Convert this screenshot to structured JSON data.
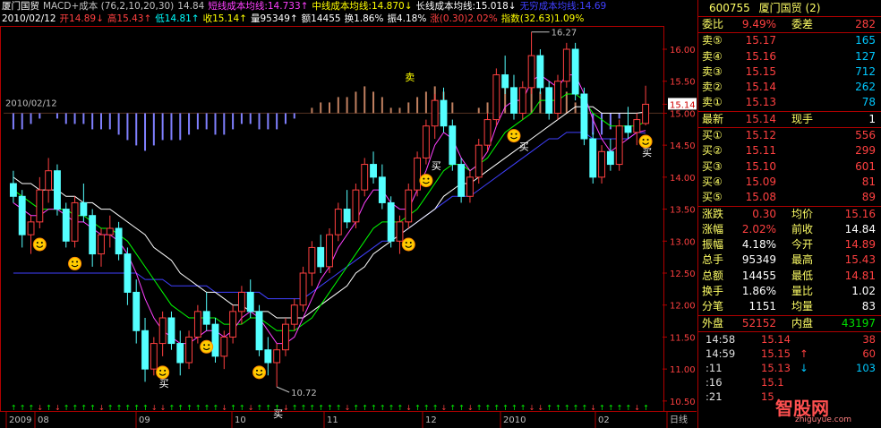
{
  "header": {
    "line1": [
      "厦门国贸",
      "MACD+成本 (76,2,10,20,30)",
      "14.84",
      "短线成本均线:14.733↑",
      "中线成本均线:14.870↓",
      "长线成本均线:15.018↓",
      "无穷成本均线:14.69"
    ],
    "line1_colors": [
      "#ffffff",
      "#c0c0c0",
      "#c0c0c0",
      "#ff40ff",
      "#ffff00",
      "#ffffff",
      "#4040ff"
    ],
    "line2": [
      "2010/02/12",
      "开14.89↓",
      "高15.43↑",
      "低14.81↑",
      "收15.14↑",
      "量95349↑",
      "额14455",
      "换1.86%",
      "振4.18%",
      "涨(0.30)2.02%",
      "指数(32.63)1.09%"
    ],
    "line2_colors": [
      "#ffffff",
      "#ff4040",
      "#ff4040",
      "#00ffff",
      "#ffff00",
      "#ffffff",
      "#ffffff",
      "#ffffff",
      "#ffffff",
      "#ff4040",
      "#ffff00"
    ]
  },
  "annotations": {
    "high_label": "16.27",
    "low_label": "10.72",
    "sell": "卖",
    "buy": "买",
    "left_date": "2010/02/12"
  },
  "price_axis": [
    "16.00",
    "15.50",
    "15.14",
    "15.00",
    "14.50",
    "14.00",
    "13.50",
    "13.00",
    "12.50",
    "12.00",
    "11.50",
    "11.00",
    "10.50"
  ],
  "date_axis": [
    "2009",
    "08",
    "09",
    "10",
    "11",
    "12",
    "2010",
    "02",
    "日线"
  ],
  "stock": {
    "code": "600755",
    "name": "厦门国贸",
    "tag": "(2)"
  },
  "quote": {
    "weibi_label": "委比",
    "weibi": "9.49%",
    "weicha_label": "委差",
    "weicha": "282",
    "sells": [
      {
        "label": "卖⑤",
        "price": "15.17",
        "vol": "165"
      },
      {
        "label": "卖④",
        "price": "15.16",
        "vol": "127"
      },
      {
        "label": "卖③",
        "price": "15.15",
        "vol": "712"
      },
      {
        "label": "卖②",
        "price": "15.14",
        "vol": "262"
      },
      {
        "label": "卖①",
        "price": "15.13",
        "vol": "78"
      }
    ],
    "latest_label": "最新",
    "latest": "15.14",
    "xianshou_label": "现手",
    "xianshou": "1",
    "buys": [
      {
        "label": "买①",
        "price": "15.12",
        "vol": "556"
      },
      {
        "label": "买②",
        "price": "15.11",
        "vol": "299"
      },
      {
        "label": "买③",
        "price": "15.10",
        "vol": "601"
      },
      {
        "label": "买④",
        "price": "15.09",
        "vol": "81"
      },
      {
        "label": "买⑤",
        "price": "15.08",
        "vol": "89"
      }
    ],
    "stats": [
      {
        "l1": "涨跌",
        "v1": "0.30",
        "c1": "red",
        "l2": "均价",
        "v2": "15.16",
        "c2": "red"
      },
      {
        "l1": "涨幅",
        "v1": "2.02%",
        "c1": "red",
        "l2": "前收",
        "v2": "14.84",
        "c2": "white"
      },
      {
        "l1": "振幅",
        "v1": "4.18%",
        "c1": "white",
        "l2": "今开",
        "v2": "14.89",
        "c2": "red"
      },
      {
        "l1": "总手",
        "v1": "95349",
        "c1": "white",
        "l2": "最高",
        "v2": "15.43",
        "c2": "red"
      },
      {
        "l1": "总额",
        "v1": "14455",
        "c1": "white",
        "l2": "最低",
        "v2": "14.81",
        "c2": "red"
      },
      {
        "l1": "换手",
        "v1": "1.86%",
        "c1": "white",
        "l2": "量比",
        "v2": "1.02",
        "c2": "white"
      },
      {
        "l1": "分笔",
        "v1": "1151",
        "c1": "white",
        "l2": "均量",
        "v2": "83",
        "c2": "white"
      }
    ],
    "waipan_label": "外盘",
    "waipan": "52152",
    "neipan_label": "内盘",
    "neipan": "43197"
  },
  "ticks": [
    {
      "time": "14:58",
      "price": "15.14",
      "arrow": "",
      "vol": "38",
      "vcolor": "#ff4040"
    },
    {
      "time": "14:59",
      "price": "15.15",
      "arrow": "↑",
      "vol": "60",
      "vcolor": "#ff4040"
    },
    {
      "time": ":11",
      "price": "15.13",
      "arrow": "↓",
      "vol": "103",
      "vcolor": "#00c8ff"
    },
    {
      "time": ":16",
      "price": "15.1",
      "arrow": "",
      "vol": "",
      "vcolor": "#ff4040"
    },
    {
      "time": ":21",
      "price": "15",
      "arrow": "",
      "vol": "",
      "vcolor": "#ff4040"
    }
  ],
  "watermark": {
    "text": "智股网",
    "url": "zhiguyue.com"
  },
  "colors": {
    "up": "#ff4040",
    "down": "#54ffff",
    "frame": "#b00000",
    "ma_short": "#ff40ff",
    "ma_mid": "#ffff00",
    "ma_long": "#ffffff",
    "ma_inf": "#4040ff",
    "ma_green": "#00ff00"
  },
  "chart_data": {
    "type": "candlestick",
    "ylim": [
      10.4,
      16.35
    ],
    "series_names": [
      "短线成本均线",
      "中线成本均线",
      "长线成本均线",
      "无穷成本均线"
    ],
    "candles": [
      [
        13.9,
        14.1,
        13.6,
        13.7
      ],
      [
        13.7,
        13.8,
        12.9,
        13.1
      ],
      [
        13.1,
        13.4,
        12.8,
        13.3
      ],
      [
        13.3,
        14.0,
        13.2,
        13.8
      ],
      [
        13.8,
        14.3,
        13.6,
        14.1
      ],
      [
        14.1,
        14.2,
        13.4,
        13.5
      ],
      [
        13.5,
        13.6,
        12.9,
        13.0
      ],
      [
        13.0,
        13.7,
        12.9,
        13.6
      ],
      [
        13.6,
        13.9,
        13.3,
        13.4
      ],
      [
        13.4,
        13.5,
        12.6,
        12.8
      ],
      [
        12.8,
        13.2,
        12.6,
        13.1
      ],
      [
        13.1,
        13.4,
        12.9,
        13.2
      ],
      [
        13.2,
        13.3,
        12.7,
        12.8
      ],
      [
        12.8,
        12.9,
        12.0,
        12.2
      ],
      [
        12.2,
        12.4,
        11.4,
        11.6
      ],
      [
        11.6,
        11.8,
        10.8,
        11.0
      ],
      [
        11.0,
        11.5,
        10.9,
        11.4
      ],
      [
        11.4,
        11.9,
        11.2,
        11.8
      ],
      [
        11.8,
        11.9,
        11.3,
        11.4
      ],
      [
        11.4,
        11.6,
        10.9,
        11.1
      ],
      [
        11.1,
        11.6,
        11.0,
        11.5
      ],
      [
        11.5,
        12.0,
        11.4,
        11.9
      ],
      [
        11.9,
        12.2,
        11.6,
        11.7
      ],
      [
        11.7,
        11.8,
        11.1,
        11.2
      ],
      [
        11.2,
        11.6,
        11.0,
        11.5
      ],
      [
        11.5,
        12.0,
        11.4,
        11.9
      ],
      [
        11.9,
        12.3,
        11.7,
        12.2
      ],
      [
        12.2,
        12.4,
        11.8,
        11.9
      ],
      [
        11.9,
        12.0,
        11.2,
        11.3
      ],
      [
        11.3,
        11.5,
        10.9,
        11.1
      ],
      [
        11.1,
        11.4,
        10.72,
        11.3
      ],
      [
        11.3,
        11.8,
        11.2,
        11.7
      ],
      [
        11.7,
        12.1,
        11.6,
        12.0
      ],
      [
        12.0,
        12.6,
        11.9,
        12.5
      ],
      [
        12.5,
        13.0,
        12.3,
        12.9
      ],
      [
        12.9,
        13.1,
        12.5,
        12.6
      ],
      [
        12.6,
        13.2,
        12.5,
        13.1
      ],
      [
        13.1,
        13.6,
        13.0,
        13.5
      ],
      [
        13.5,
        13.8,
        13.2,
        13.3
      ],
      [
        13.3,
        13.9,
        13.2,
        13.8
      ],
      [
        13.8,
        14.3,
        13.7,
        14.2
      ],
      [
        14.2,
        14.4,
        13.9,
        14.0
      ],
      [
        14.0,
        14.2,
        13.5,
        13.6
      ],
      [
        13.6,
        13.7,
        12.9,
        13.0
      ],
      [
        13.0,
        13.4,
        12.8,
        13.3
      ],
      [
        13.3,
        13.9,
        13.2,
        13.8
      ],
      [
        13.8,
        14.4,
        13.7,
        14.3
      ],
      [
        14.3,
        14.9,
        14.2,
        14.8
      ],
      [
        14.8,
        15.3,
        14.6,
        15.2
      ],
      [
        15.2,
        15.4,
        14.7,
        14.8
      ],
      [
        14.8,
        14.9,
        14.1,
        14.2
      ],
      [
        14.2,
        14.3,
        13.6,
        13.7
      ],
      [
        13.7,
        14.1,
        13.6,
        14.0
      ],
      [
        14.0,
        14.6,
        13.9,
        14.5
      ],
      [
        14.5,
        15.0,
        14.4,
        14.9
      ],
      [
        14.9,
        15.7,
        14.8,
        15.6
      ],
      [
        15.6,
        15.9,
        15.3,
        15.4
      ],
      [
        15.4,
        15.6,
        14.9,
        15.0
      ],
      [
        15.0,
        15.5,
        14.9,
        15.4
      ],
      [
        15.4,
        16.27,
        15.3,
        15.9
      ],
      [
        15.9,
        16.0,
        15.3,
        15.4
      ],
      [
        15.4,
        15.5,
        14.9,
        15.0
      ],
      [
        15.0,
        15.6,
        14.9,
        15.5
      ],
      [
        15.5,
        16.1,
        15.4,
        16.0
      ],
      [
        16.0,
        16.1,
        15.2,
        15.3
      ],
      [
        15.3,
        15.4,
        14.5,
        14.6
      ],
      [
        14.6,
        14.7,
        13.9,
        14.0
      ],
      [
        14.0,
        14.5,
        13.9,
        14.4
      ],
      [
        14.4,
        14.6,
        14.1,
        14.2
      ],
      [
        14.2,
        14.9,
        14.1,
        14.8
      ],
      [
        14.8,
        15.1,
        14.6,
        14.7
      ],
      [
        14.7,
        15.0,
        14.5,
        14.9
      ],
      [
        14.84,
        15.43,
        14.81,
        15.14
      ]
    ],
    "ma_short": [
      13.6,
      13.5,
      13.4,
      13.4,
      13.5,
      13.5,
      13.4,
      13.3,
      13.3,
      13.2,
      13.1,
      13.1,
      13.0,
      12.8,
      12.5,
      12.1,
      11.8,
      11.6,
      11.5,
      11.4,
      11.4,
      11.5,
      11.6,
      11.6,
      11.5,
      11.6,
      11.8,
      11.9,
      11.8,
      11.6,
      11.4,
      11.4,
      11.5,
      11.8,
      12.1,
      12.4,
      12.6,
      12.9,
      13.1,
      13.3,
      13.6,
      13.8,
      13.8,
      13.6,
      13.5,
      13.5,
      13.8,
      14.1,
      14.5,
      14.7,
      14.6,
      14.3,
      14.1,
      14.2,
      14.4,
      14.8,
      15.1,
      15.2,
      15.2,
      15.5,
      15.6,
      15.5,
      15.4,
      15.6,
      15.6,
      15.3,
      14.9,
      14.6,
      14.4,
      14.5,
      14.6,
      14.7,
      14.73
    ],
    "ma_mid": [
      13.8,
      13.7,
      13.6,
      13.5,
      13.5,
      13.5,
      13.5,
      13.4,
      13.4,
      13.3,
      13.2,
      13.2,
      13.1,
      13.0,
      12.8,
      12.6,
      12.4,
      12.2,
      12.0,
      11.9,
      11.8,
      11.8,
      11.8,
      11.8,
      11.7,
      11.7,
      11.7,
      11.8,
      11.8,
      11.7,
      11.6,
      11.6,
      11.6,
      11.7,
      11.8,
      12.0,
      12.2,
      12.4,
      12.6,
      12.8,
      13.0,
      13.2,
      13.3,
      13.3,
      13.3,
      13.4,
      13.5,
      13.7,
      13.9,
      14.1,
      14.2,
      14.2,
      14.1,
      14.2,
      14.3,
      14.5,
      14.7,
      14.8,
      14.9,
      15.0,
      15.2,
      15.2,
      15.2,
      15.3,
      15.3,
      15.2,
      15.0,
      14.9,
      14.8,
      14.8,
      14.8,
      14.8,
      14.87
    ],
    "ma_long": [
      14.0,
      13.9,
      13.9,
      13.8,
      13.8,
      13.8,
      13.7,
      13.7,
      13.6,
      13.6,
      13.5,
      13.5,
      13.4,
      13.3,
      13.2,
      13.1,
      12.9,
      12.8,
      12.7,
      12.5,
      12.4,
      12.3,
      12.2,
      12.2,
      12.1,
      12.0,
      12.0,
      11.9,
      11.9,
      11.9,
      11.8,
      11.8,
      11.8,
      11.8,
      11.9,
      12.0,
      12.1,
      12.2,
      12.3,
      12.5,
      12.6,
      12.8,
      12.9,
      13.0,
      13.1,
      13.2,
      13.3,
      13.4,
      13.5,
      13.7,
      13.8,
      13.9,
      13.9,
      14.0,
      14.1,
      14.2,
      14.3,
      14.4,
      14.5,
      14.6,
      14.7,
      14.8,
      14.9,
      15.0,
      15.1,
      15.1,
      15.1,
      15.0,
      15.0,
      15.0,
      15.0,
      15.0,
      15.02
    ],
    "ma_inf": [
      12.5,
      12.5,
      12.5,
      12.5,
      12.5,
      12.5,
      12.5,
      12.5,
      12.5,
      12.5,
      12.5,
      12.5,
      12.5,
      12.5,
      12.5,
      12.4,
      12.4,
      12.4,
      12.3,
      12.3,
      12.3,
      12.3,
      12.3,
      12.2,
      12.2,
      12.2,
      12.2,
      12.2,
      12.2,
      12.1,
      12.1,
      12.1,
      12.1,
      12.1,
      12.2,
      12.3,
      12.4,
      12.5,
      12.6,
      12.7,
      12.8,
      12.9,
      13.0,
      13.0,
      13.1,
      13.2,
      13.3,
      13.4,
      13.5,
      13.6,
      13.7,
      13.7,
      13.7,
      13.8,
      13.9,
      14.0,
      14.1,
      14.2,
      14.3,
      14.4,
      14.5,
      14.6,
      14.6,
      14.7,
      14.7,
      14.7,
      14.6,
      14.6,
      14.6,
      14.6,
      14.6,
      14.7,
      14.69
    ],
    "macd_hist": [
      -0.3,
      -0.3,
      -0.2,
      -0.1,
      0.0,
      -0.1,
      -0.2,
      -0.2,
      -0.2,
      -0.3,
      -0.3,
      -0.3,
      -0.4,
      -0.5,
      -0.6,
      -0.7,
      -0.6,
      -0.5,
      -0.5,
      -0.5,
      -0.4,
      -0.3,
      -0.3,
      -0.4,
      -0.4,
      -0.3,
      -0.2,
      -0.2,
      -0.3,
      -0.3,
      -0.3,
      -0.2,
      -0.1,
      0.0,
      0.1,
      0.2,
      0.2,
      0.3,
      0.3,
      0.4,
      0.5,
      0.4,
      0.3,
      0.1,
      0.1,
      0.2,
      0.3,
      0.4,
      0.5,
      0.4,
      0.2,
      0.0,
      0.0,
      0.1,
      0.2,
      0.4,
      0.5,
      0.4,
      0.4,
      0.5,
      0.4,
      0.3,
      0.3,
      0.4,
      0.2,
      -0.1,
      -0.4,
      -0.4,
      -0.3,
      -0.1,
      0.0,
      0.0,
      0.1
    ],
    "smileys": [
      3,
      7,
      17,
      22,
      28,
      45,
      47,
      57,
      72
    ],
    "buy_markers": [
      17,
      30,
      48,
      58,
      75
    ],
    "sell_markers": [
      45
    ]
  }
}
